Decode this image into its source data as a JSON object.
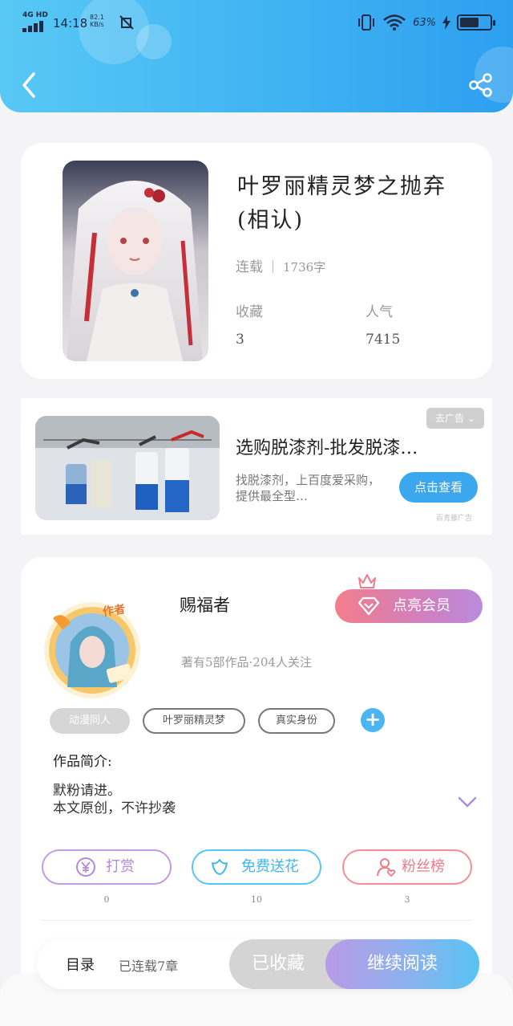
{
  "status_bar": {
    "network": "4G HD",
    "time": "14:18",
    "speed": "82.1",
    "speed_unit": "KB/s",
    "battery": "63%",
    "battery_level": 0.63
  },
  "colors": {
    "header": "#3fb3f2",
    "accent_blue": "#3aa7ee",
    "vip_gradient_start": "#f37e8c",
    "vip_gradient_end": "#b98cdb"
  },
  "header": {
    "back_icon": "chevron-left-icon",
    "share_icon": "share-icon"
  },
  "book": {
    "title": "叶罗丽精灵梦之抛弃(相认)",
    "status": "连载",
    "words": "1736字",
    "stats": [
      {
        "label": "收藏",
        "value": "3"
      },
      {
        "label": "人气",
        "value": "7415"
      }
    ]
  },
  "ad": {
    "tag": "去广告",
    "title": "选购脱漆剂-批发脱漆…",
    "description": "找脱漆剂，上百度爱采购，提供最全型…",
    "button": "点击查看",
    "source": "百青藤广告"
  },
  "author": {
    "badge": "作者",
    "name": "赐福者",
    "info": "著有5部作品·204人关注",
    "vip_button": "点亮会员",
    "tags": [
      "动漫同人",
      "叶罗丽精灵梦",
      "真实身份"
    ],
    "intro_label": "作品简介:",
    "intro_text": "默粉请进。\n本文原创，不许抄袭"
  },
  "actions": [
    {
      "label": "打赏",
      "count": "0",
      "icon": "yen-icon"
    },
    {
      "label": "免费送花",
      "count": "10",
      "icon": "flower-icon"
    },
    {
      "label": "粉丝榜",
      "count": "3",
      "icon": "fan-rank-icon"
    }
  ],
  "bottom_bar": {
    "toc": "目录",
    "serial": "已连载7章",
    "collected": "已收藏",
    "read": "继续阅读"
  }
}
